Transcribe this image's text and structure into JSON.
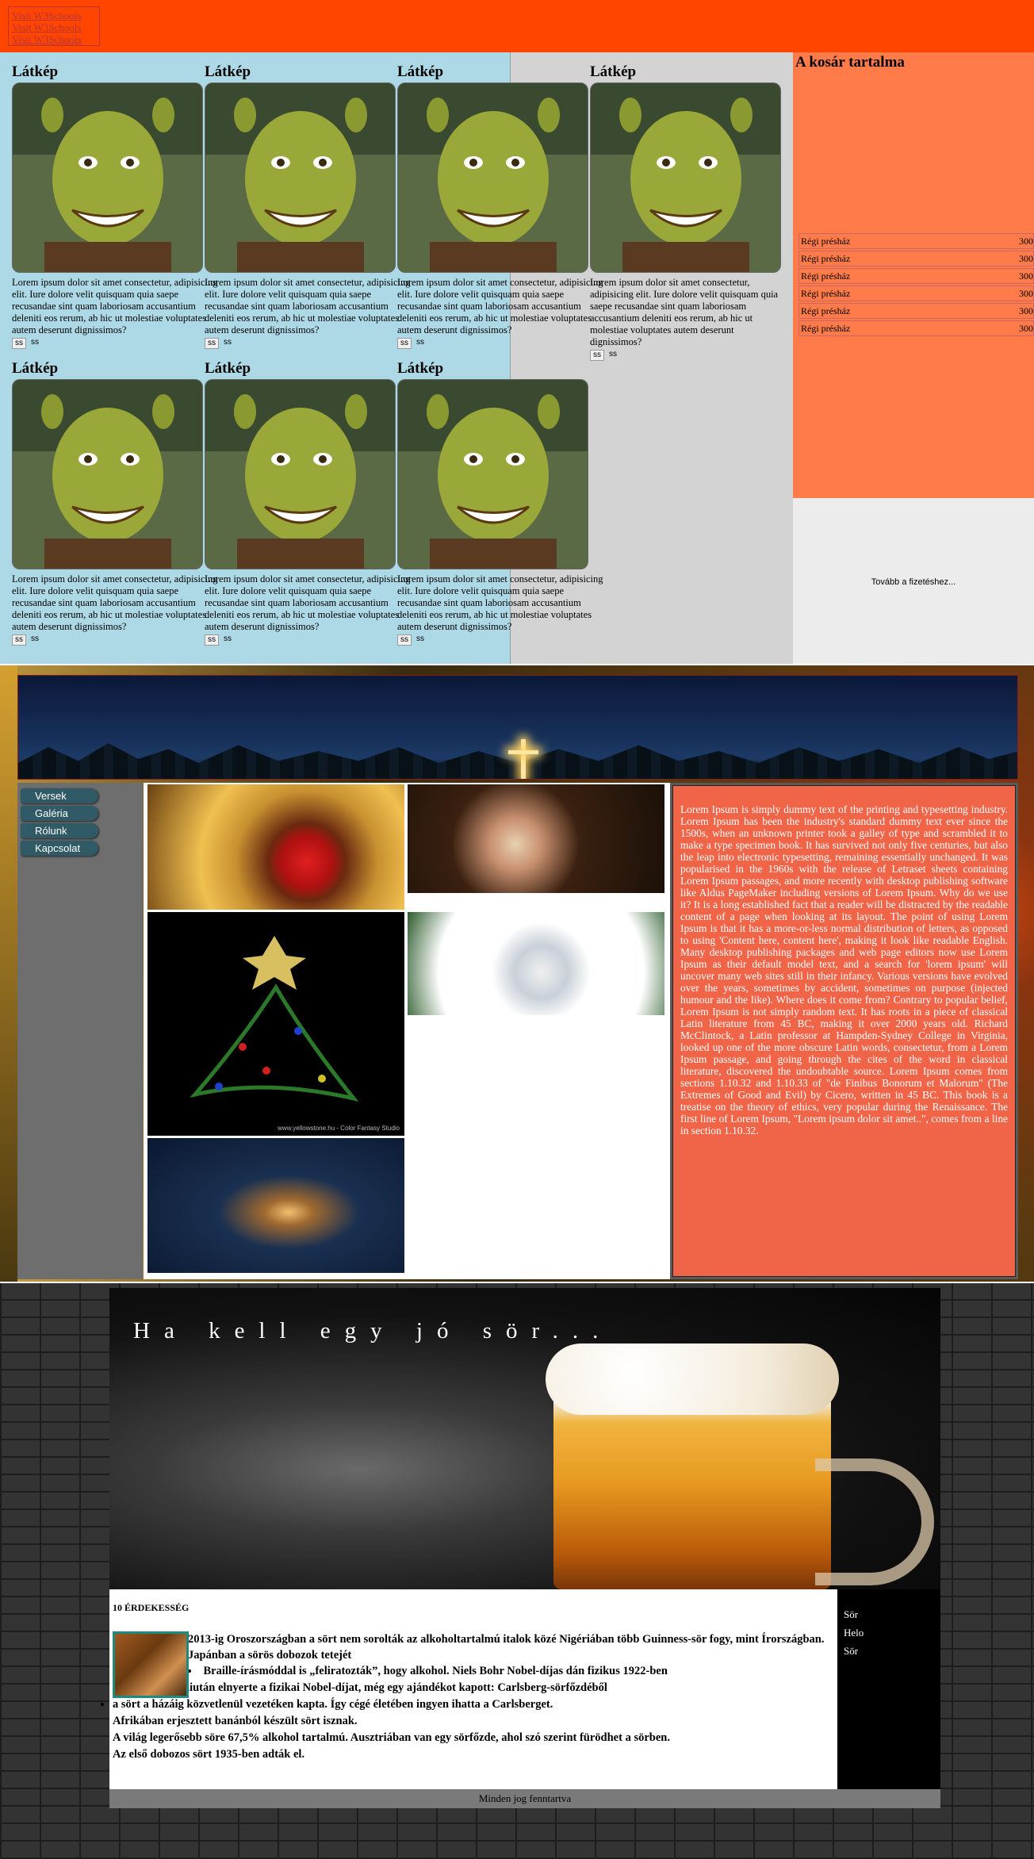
{
  "section1": {
    "logo_lines": [
      "Visit W3Schools",
      "Visit W3Schools",
      "Visit W3Schools"
    ],
    "product_title": "Látkép",
    "product_text": "Lorem ipsum dolor sit amet consectetur, adipisicing elit. Iure dolore velit quisquam quia saepe recusandae sint quam laboriosam accusantium deleniti eos rerum, ab hic ut molestiae voluptates autem deserunt dignissimos?",
    "product_btn": "ss",
    "product_btn2": "ss",
    "cart_title": "A kosár tartalma",
    "cart_items": [
      {
        "name": "Régi présház",
        "price": "300"
      },
      {
        "name": "Régi présház",
        "price": "300"
      },
      {
        "name": "Régi présház",
        "price": "300"
      },
      {
        "name": "Régi présház",
        "price": "300"
      },
      {
        "name": "Régi présház",
        "price": "300"
      },
      {
        "name": "Régi présház",
        "price": "300"
      }
    ],
    "checkout_label": "Tovább a fizetéshez...",
    "colors": {
      "header": "#ff4500",
      "products_bg": "#add8e6",
      "cart_bg": "#ff7b4a"
    }
  },
  "section2": {
    "menu": [
      "Versek",
      "Galéria",
      "Rólunk",
      "Kapcsolat"
    ],
    "text": "Lorem Ipsum is simply dummy text of the printing and typesetting industry. Lorem Ipsum has been the industry's standard dummy text ever since the 1500s, when an unknown printer took a galley of type and scrambled it to make a type specimen book. It has survived not only five centuries, but also the leap into electronic typesetting, remaining essentially unchanged. It was popularised in the 1960s with the release of Letraset sheets containing Lorem Ipsum passages, and more recently with desktop publishing software like Aldus PageMaker including versions of Lorem Ipsum. Why do we use it? It is a long established fact that a reader will be distracted by the readable content of a page when looking at its layout. The point of using Lorem Ipsum is that it has a more-or-less normal distribution of letters, as opposed to using 'Content here, content here', making it look like readable English. Many desktop publishing packages and web page editors now use Lorem Ipsum as their default model text, and a search for 'lorem ipsum' will uncover many web sites still in their infancy. Various versions have evolved over the years, sometimes by accident, sometimes on purpose (injected humour and the like). Where does it come from? Contrary to popular belief, Lorem Ipsum is not simply random text. It has roots in a piece of classical Latin literature from 45 BC, making it over 2000 years old. Richard McClintock, a Latin professor at Hampden-Sydney College in Virginia, looked up one of the more obscure Latin words, consectetur, from a Lorem Ipsum passage, and going through the cites of the word in classical literature, discovered the undoubtable source. Lorem Ipsum comes from sections 1.10.32 and 1.10.33 of \"de Finibus Bonorum et Malorum\" (The Extremes of Good and Evil) by Cicero, written in 45 BC. This book is a treatise on the theory of ethics, very popular during the Renaissance. The first line of Lorem Ipsum, \"Lorem ipsum dolor sit amet..\", comes from a line in section 1.10.32.",
    "image_caption": "www.yellowstone.hu - Color Fantasy Studio"
  },
  "section3": {
    "hero_title": "Ha kell egy jó sör...",
    "heading": "10 ÉRDEKESSÉG",
    "fact1": "2013-ig Oroszországban a sört nem sorolták az alkoholtartalmú italok közé Nigériában több Guinness-sör fogy, mint Írországban. Japánban a sörös dobozok tetejét",
    "list_items": [
      "Braille-írásmóddal is „feliratozták”, hogy alkohol. Niels Bohr Nobel-díjas dán fizikus 1922-ben",
      "miután elnyerte a fizikai Nobel-díjat, még egy ajándékot kapott: Carlsberg-sörfőzdéből",
      "a sört a házáig közvetlenül vezetéken kapta. Így cégé életében ingyen ihatta a Carlsberget."
    ],
    "extra_lines": [
      "Afrikában erjesztett banánból készült sört isznak.",
      "A világ legerősebb söre 67,5% alkohol tartalmú. Ausztriában van egy sörfőzde, ahol szó szerint fürödhet a sörben.",
      "Az első dobozos sört 1935-ben adták el."
    ],
    "side_links": [
      "Sör",
      "Helo",
      "Sör"
    ],
    "footer": "Minden jog fenntartva"
  }
}
